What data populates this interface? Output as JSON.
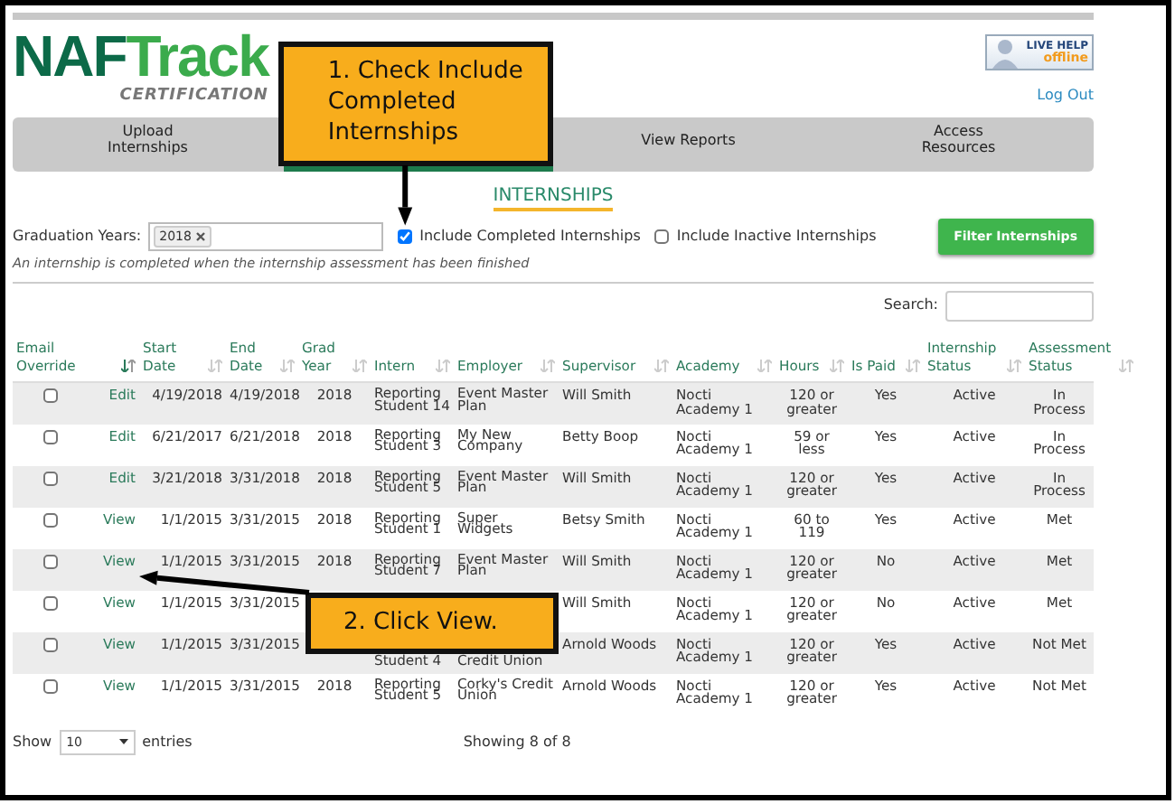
{
  "header": {
    "logo": [
      "NAF",
      "Track"
    ],
    "tagline": "CERTIFICATION",
    "live_help": {
      "title": "LIVE HELP",
      "status": "offline"
    },
    "logout": "Log Out"
  },
  "nav": [
    {
      "label": "Upload Internships",
      "selected": false
    },
    {
      "selected": true
    },
    {
      "label": "View Reports",
      "selected": false
    },
    {
      "label": "Access Resources",
      "selected": false
    }
  ],
  "page_title": "INTERNSHIPS",
  "filters": {
    "label": "Graduation Years:",
    "tags": [
      "2018"
    ],
    "options": [
      {
        "label": "Include Completed Internships",
        "checked": true
      },
      {
        "label": "Include Inactive Internships",
        "checked": false
      }
    ],
    "button": "Filter Internships",
    "note": "An internship is completed when the internship assessment has been finished"
  },
  "search": {
    "label": "Search:"
  },
  "table": {
    "checkbox_column": {
      "label": "Email Override"
    },
    "action_column": {
      "sortable": true,
      "sorted": true
    },
    "columns": [
      {
        "label": "Start Date",
        "sortable": true,
        "sorted": false
      },
      {
        "label": "End Date",
        "sortable": true,
        "sorted": false
      },
      {
        "label": "Grad Year",
        "sortable": true,
        "sorted": false
      },
      {
        "label": "Intern",
        "sortable": true,
        "sorted": false
      },
      {
        "label": "Employer",
        "sortable": true,
        "sorted": false
      },
      {
        "label": "Supervisor",
        "sortable": true,
        "sorted": false
      },
      {
        "label": "Academy",
        "sortable": true,
        "sorted": false
      },
      {
        "label": "Hours",
        "sortable": true,
        "sorted": false
      },
      {
        "label": "Is Paid",
        "sortable": true,
        "sorted": false
      },
      {
        "label": "Internship Status",
        "sortable": true,
        "sorted": false
      },
      {
        "label": "Assessment Status",
        "sortable": true,
        "sorted": false
      }
    ],
    "rows": [
      {
        "checked": false,
        "action": "Edit",
        "cells": [
          "4/19/2018",
          "4/19/2018",
          "2018",
          "Reporting Student 14",
          "Event Master Plan",
          "Will Smith",
          "Nocti Academy 1",
          "120 or greater",
          "Yes",
          "Active",
          "In Process"
        ]
      },
      {
        "checked": false,
        "action": "Edit",
        "cells": [
          "6/21/2017",
          "6/21/2018",
          "2018",
          "Reporting Student 3",
          "My New Company",
          "Betty Boop",
          "Nocti Academy 1",
          "59 or less",
          "Yes",
          "Active",
          "In Process"
        ]
      },
      {
        "checked": false,
        "action": "Edit",
        "cells": [
          "3/21/2018",
          "3/31/2018",
          "2018",
          "Reporting Student 5",
          "Event Master Plan",
          "Will Smith",
          "Nocti Academy 1",
          "120 or greater",
          "Yes",
          "Active",
          "In Process"
        ]
      },
      {
        "checked": false,
        "action": "View",
        "cells": [
          "1/1/2015",
          "3/31/2015",
          "2018",
          "Reporting Student 1",
          "Super Widgets",
          "Betsy Smith",
          "Nocti Academy 1",
          "60 to 119",
          "Yes",
          "Active",
          "Met"
        ]
      },
      {
        "checked": false,
        "action": "View",
        "cells": [
          "1/1/2015",
          "3/31/2015",
          "2018",
          "Reporting Student 7",
          "Event Master Plan",
          "Will Smith",
          "Nocti Academy 1",
          "120 or greater",
          "No",
          "Active",
          "Met"
        ]
      },
      {
        "checked": false,
        "action": "View",
        "cells": [
          "1/1/2015",
          "3/31/2015",
          null,
          null,
          null,
          "Will Smith",
          "Nocti Academy 1",
          "120 or greater",
          "No",
          "Active",
          "Met"
        ]
      },
      {
        "checked": false,
        "action": "View",
        "cells": [
          "1/1/2015",
          "3/31/2015",
          null,
          "Student 4",
          "Credit Union",
          "Arnold Woods",
          "Nocti Academy 1",
          "120 or greater",
          "Yes",
          "Active",
          "Not Met"
        ]
      },
      {
        "checked": false,
        "action": "View",
        "cells": [
          "1/1/2015",
          "3/31/2015",
          "2018",
          "Reporting Student 5",
          "Corky's Credit Union",
          "Arnold Woods",
          "Nocti Academy 1",
          "120 or greater",
          "Yes",
          "Active",
          "Not Met"
        ]
      }
    ]
  },
  "footer": {
    "show": "Show",
    "length": "10",
    "entries": "entries",
    "info": "Showing 8 of 8"
  },
  "callouts": [
    {
      "text": "1. Check Include Completed Internships"
    },
    {
      "text": "2. Click View."
    }
  ]
}
